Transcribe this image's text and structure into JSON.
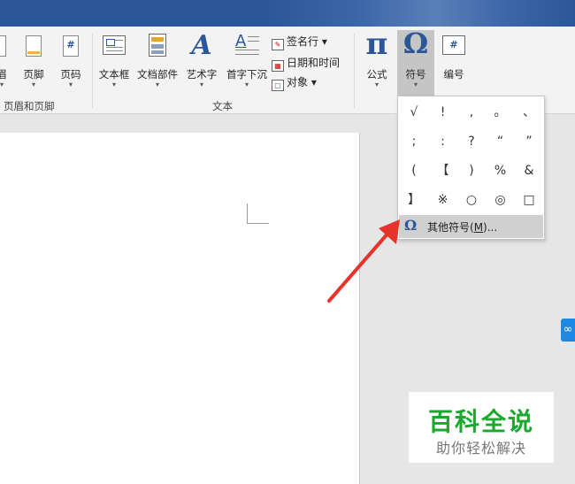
{
  "ribbon": {
    "header_footer_group": {
      "label": "页眉和页脚",
      "buttons": [
        {
          "label": "眉"
        },
        {
          "label": "页脚"
        },
        {
          "label": "页码",
          "icon": "#"
        }
      ]
    },
    "text_group": {
      "label": "文本",
      "buttons": [
        {
          "label": "文本框"
        },
        {
          "label": "文档部件"
        },
        {
          "label": "艺术字",
          "icon": "A"
        },
        {
          "label": "首字下沉",
          "icon": "A"
        }
      ],
      "small_buttons": [
        {
          "label": "签名行 ▾"
        },
        {
          "label": "日期和时间"
        },
        {
          "label": "对象 ▾"
        }
      ]
    },
    "symbols_group": {
      "buttons": [
        {
          "label": "公式",
          "icon": "π"
        },
        {
          "label": "符号",
          "icon": "Ω"
        },
        {
          "label": "编号",
          "icon": "#"
        }
      ]
    },
    "dropdown_arrow": "▾"
  },
  "symbol_dropdown": {
    "symbols": [
      "√",
      "!",
      ",",
      "。",
      "、",
      ";",
      ":",
      "?",
      "“",
      "”",
      "(",
      "【",
      ")",
      "%",
      "&",
      "】",
      "※",
      "○",
      "◎",
      "□"
    ],
    "more_symbols": {
      "icon": "Ω",
      "text_before": "其他符号(",
      "mnemonic": "M",
      "text_after": ")..."
    }
  },
  "watermark": {
    "title": "百科全说",
    "subtitle": "助你轻松解决"
  },
  "side_tab_icon": "link-icon",
  "colors": {
    "title_bar": "#2b579a",
    "ribbon_bg": "#f3f3f3",
    "arrow_red": "#e8332c",
    "watermark_green": "#1aa82e",
    "accent_blue": "#2b579a"
  }
}
